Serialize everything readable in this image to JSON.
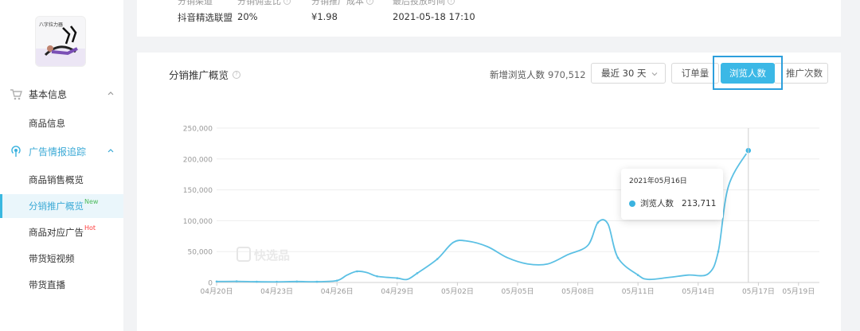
{
  "sidebar": {
    "product_caption": "八字拉力器",
    "groups": [
      {
        "label": "基本信息",
        "icon": "cart-icon",
        "items": [
          {
            "label": "商品信息"
          }
        ]
      },
      {
        "label": "广告情报追踪",
        "icon": "broadcast-icon",
        "items": [
          {
            "label": "商品销售概览"
          },
          {
            "label": "分销推广概览",
            "badge": "New"
          },
          {
            "label": "商品对应广告",
            "badge": "Hot"
          },
          {
            "label": "带货短视频"
          },
          {
            "label": "带货直播"
          }
        ]
      }
    ]
  },
  "info": {
    "columns": [
      {
        "label": "分销渠道",
        "value": "抖音精选联盟"
      },
      {
        "label": "分销佣金比",
        "value": "20%"
      },
      {
        "label": "分销推广成本",
        "value": "¥1.98"
      },
      {
        "label": "最后投放时间",
        "value": "2021-05-18 17:10"
      }
    ]
  },
  "panel": {
    "title": "分销推广概览",
    "stat_label": "新增浏览人数",
    "stat_value": "970,512",
    "range": "最近 30 天",
    "btn_orders": "订单量",
    "btn_visitors": "浏览人数",
    "btn_promo": "推广次数",
    "watermark": "快选品"
  },
  "tooltip": {
    "date": "2021年05月16日",
    "series": "浏览人数",
    "value": "213,711"
  },
  "colors": {
    "accent": "#3bb8e6",
    "line": "#5bc0e4",
    "highlight": "#2d9fdc"
  },
  "chart_data": {
    "type": "line",
    "y_ticks": [
      "0",
      "50,000",
      "100,000",
      "150,000",
      "200,000",
      "250,000"
    ],
    "ylim": [
      0,
      250000
    ],
    "x_tick_labels": [
      "04月20日",
      "04月23日",
      "04月26日",
      "04月29日",
      "05月02日",
      "05月05日",
      "05月08日",
      "05月11日",
      "05月14日",
      "05月17日",
      "05月19日"
    ],
    "x_tick_days": [
      0,
      3,
      6,
      9,
      12,
      15,
      18,
      21,
      24,
      27,
      29
    ],
    "grid": "horizontal",
    "series": [
      {
        "name": "浏览人数",
        "values": [
          [
            0,
            1500
          ],
          [
            1,
            1800
          ],
          [
            2,
            1200
          ],
          [
            3,
            1000
          ],
          [
            4,
            1500
          ],
          [
            5,
            1200
          ],
          [
            6,
            3000
          ],
          [
            6.5,
            12000
          ],
          [
            7,
            18000
          ],
          [
            7.5,
            16000
          ],
          [
            8,
            10000
          ],
          [
            9,
            7000
          ],
          [
            9.5,
            5000
          ],
          [
            10,
            15000
          ],
          [
            11,
            38000
          ],
          [
            11.8,
            65000
          ],
          [
            12.5,
            67000
          ],
          [
            13.5,
            58000
          ],
          [
            14.5,
            40000
          ],
          [
            15.5,
            30000
          ],
          [
            16.5,
            30000
          ],
          [
            17.5,
            45000
          ],
          [
            18.5,
            60000
          ],
          [
            19,
            97000
          ],
          [
            19.5,
            95000
          ],
          [
            20,
            40000
          ],
          [
            21,
            12000
          ],
          [
            21.5,
            5000
          ],
          [
            22.5,
            8000
          ],
          [
            23.5,
            12000
          ],
          [
            24.5,
            14000
          ],
          [
            25,
            50000
          ],
          [
            25.5,
            155000
          ],
          [
            26.5,
            213711
          ]
        ]
      }
    ],
    "hover_day": 26.5
  }
}
